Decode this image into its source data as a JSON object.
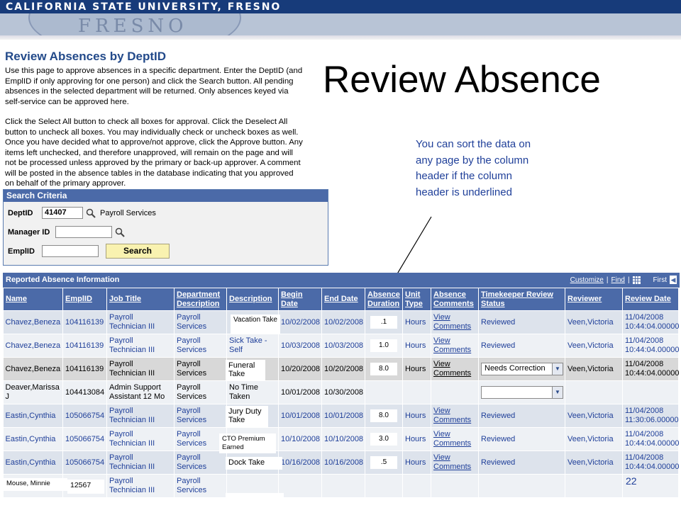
{
  "banner": {
    "title": "CALIFORNIA STATE UNIVERSITY, FRESNO",
    "seal_text": "FRESNO"
  },
  "page": {
    "heading": "Review Absences by DeptID",
    "instructions_1": "Use this page to approve absences in a specific department. Enter the DeptID (and EmplID if only approving for one person) and click the Search button. All pending absences in the selected department will be returned. Only absences keyed via self-service can be approved here.",
    "instructions_2": "Click the Select All button to check all boxes for approval. Click the Deselect All button to uncheck all boxes. You may individually check or uncheck boxes as well. Once you have decided what to approve/not approve, click the Approve button. Any items left unchecked, and therefore unapproved, will remain on the page and will not be processed unless approved by the primary or back-up approver. A comment will be posted in the absence tables in the database indicating that you approved on behalf of the primary approver."
  },
  "slide": {
    "title": "Review Absence",
    "callout": "You can sort the data on any page by the column header if the column header is underlined",
    "page_number": "22"
  },
  "search": {
    "header": "Search Criteria",
    "deptid_label": "DeptID",
    "deptid_value": "41407",
    "dept_desc": "Payroll Services",
    "manager_label": "Manager ID",
    "manager_value": "",
    "emplid_label": "EmplID",
    "emplid_value": "",
    "search_label": "Search"
  },
  "grid": {
    "header": "Reported Absence Information",
    "customize": "Customize",
    "find": "Find",
    "first": "First",
    "columns": [
      "Name",
      "EmplID",
      "Job Title",
      "Department Description",
      "Description",
      "Begin Date",
      "End Date",
      "Absence Duration",
      "Unit Type",
      "Absence Comments",
      "Timekeeper Review Status",
      "Reviewer",
      "Review Date"
    ],
    "rows": [
      {
        "name": "Chavez,Beneza",
        "emplid": "104116139",
        "job": "Payroll Technician III",
        "dept": "Payroll Services",
        "desc": "",
        "begin": "10/02/2008",
        "end": "10/02/2008",
        "duration": "",
        "unit": "Hours",
        "comments": "View Comments",
        "status": "Reviewed",
        "reviewer": "Veen,Victoria",
        "review_date": "11/04/2008 10:44:04.00000"
      },
      {
        "name": "Chavez,Beneza",
        "emplid": "104116139",
        "job": "Payroll Technician III",
        "dept": "Payroll Services",
        "desc": "Sick Take - Self",
        "begin": "10/03/2008",
        "end": "10/03/2008",
        "duration": "",
        "unit": "Hours",
        "comments": "View Comments",
        "status": "Reviewed",
        "reviewer": "Veen,Victoria",
        "review_date": "11/04/2008 10:44:04.00000"
      },
      {
        "name": "Chavez,Beneza",
        "emplid": "104116139",
        "job": "Payroll Technician III",
        "dept": "Payroll Services",
        "desc": "",
        "begin": "10/20/2008",
        "end": "10/20/2008",
        "duration": "",
        "unit": "Hours",
        "comments": "View Comments",
        "status": "Needs Correction",
        "reviewer": "Veen,Victoria",
        "review_date": "11/04/2008 10:44:04.00000"
      },
      {
        "name": "Deaver,Marissa J",
        "emplid": "104413084",
        "job": "Admin Support Assistant 12 Mo",
        "dept": "Payroll Services",
        "desc": "No Time Taken",
        "begin": "10/01/2008",
        "end": "10/30/2008",
        "duration": "",
        "unit": "",
        "comments": "",
        "status": "",
        "reviewer": "",
        "review_date": ""
      },
      {
        "name": "Eastin,Cynthia",
        "emplid": "105066754",
        "job": "Payroll Technician III",
        "dept": "Payroll Services",
        "desc": "",
        "begin": "10/01/2008",
        "end": "10/01/2008",
        "duration": "",
        "unit": "Hours",
        "comments": "View Comments",
        "status": "Reviewed",
        "reviewer": "Veen,Victoria",
        "review_date": "11/04/2008 11:30:06.00000"
      },
      {
        "name": "Eastin,Cynthia",
        "emplid": "105066754",
        "job": "Payroll Technician III",
        "dept": "Payroll Services",
        "desc": "",
        "begin": "10/10/2008",
        "end": "10/10/2008",
        "duration": "",
        "unit": "Hours",
        "comments": "View Comments",
        "status": "Reviewed",
        "reviewer": "Veen,Victoria",
        "review_date": "11/04/2008 10:44:04.00000"
      },
      {
        "name": "Eastin,Cynthia",
        "emplid": "105066754",
        "job": "Payroll Technician III",
        "dept": "Payroll Services",
        "desc": "",
        "begin": "10/16/2008",
        "end": "10/16/2008",
        "duration": "",
        "unit": "Hours",
        "comments": "View Comments",
        "status": "Reviewed",
        "reviewer": "Veen,Victoria",
        "review_date": "11/04/2008 10:44:04.00000"
      },
      {
        "name": "",
        "emplid": "",
        "job": "Payroll Technician III",
        "dept": "Payroll Services",
        "desc": "",
        "begin": "",
        "end": "",
        "duration": "",
        "unit": "",
        "comments": "",
        "status": "",
        "reviewer": "",
        "review_date": ""
      }
    ]
  },
  "overlays": {
    "vacation": "Vacation Take",
    "funeral": "Funeral Take",
    "jury": "Jury Duty Take",
    "cto": "CTO Premium Earned",
    "dock": "Dock   Take",
    "mouse": "Mouse, Minnie",
    "mouse_id": "12567",
    "durations": [
      ".1",
      "1.0",
      "8.0",
      "8.0",
      "3.0",
      ".5"
    ]
  },
  "colors": {
    "banner": "#173b7a",
    "grid_header": "#4b6aa8",
    "callout_text": "#1f3f99",
    "search_button": "#f9f2b0"
  }
}
